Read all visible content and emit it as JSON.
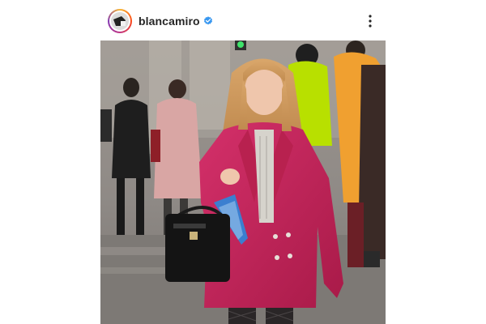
{
  "post": {
    "username": "blancamiro",
    "verified": true,
    "more_icon": "more-options-icon",
    "media_kind": "photo"
  },
  "colors": {
    "username_text": "#262626",
    "verified_badge": "#3897f0",
    "avatar_ring": "#c13584",
    "coat": "#c4245a"
  }
}
